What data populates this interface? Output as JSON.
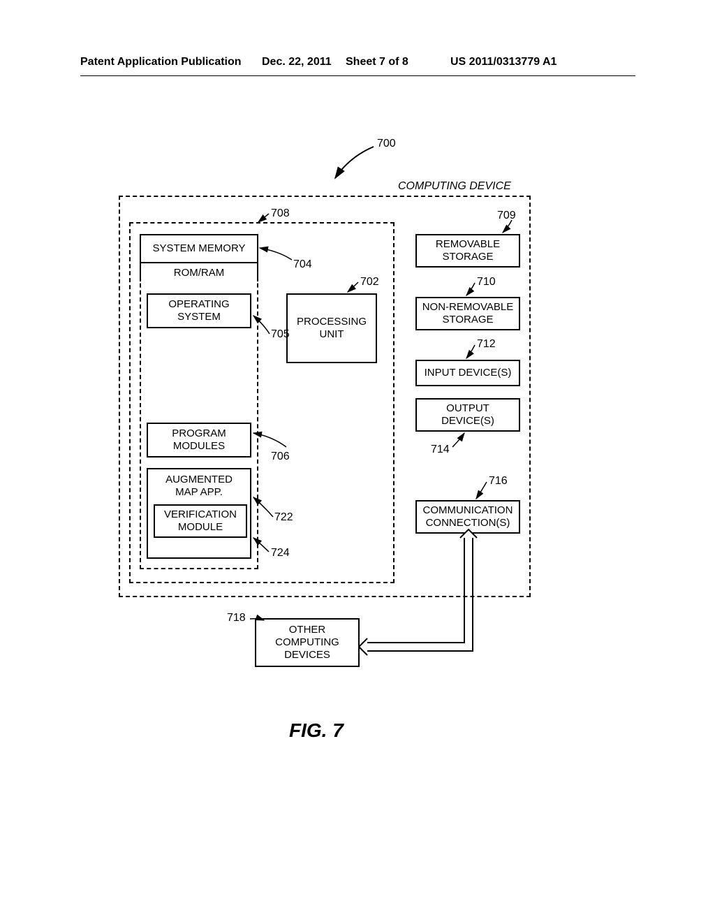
{
  "header": {
    "pub": "Patent Application Publication",
    "date": "Dec. 22, 2011",
    "sheet": "Sheet 7 of 8",
    "pubno": "US 2011/0313779 A1"
  },
  "labels": {
    "computing_device": "COMPUTING DEVICE",
    "system_memory": "SYSTEM MEMORY",
    "rom_ram": "ROM/RAM",
    "operating_system": "OPERATING\nSYSTEM",
    "program_modules": "PROGRAM\nMODULES",
    "augmented_map": "AUGMENTED\nMAP APP.",
    "verification": "VERIFICATION\nMODULE",
    "processing_unit": "PROCESSING\nUNIT",
    "removable_storage": "REMOVABLE\nSTORAGE",
    "non_removable_storage": "NON-REMOVABLE\nSTORAGE",
    "input_devices": "INPUT DEVICE(S)",
    "output_devices": "OUTPUT\nDEVICE(S)",
    "communication": "COMMUNICATION\nCONNECTION(S)",
    "other_devices": "OTHER\nCOMPUTING\nDEVICES",
    "fig": "FIG. 7"
  },
  "refs": {
    "r700": "700",
    "r702": "702",
    "r704": "704",
    "r705": "705",
    "r706": "706",
    "r708": "708",
    "r709": "709",
    "r710": "710",
    "r712": "712",
    "r714": "714",
    "r716": "716",
    "r718": "718",
    "r722": "722",
    "r724": "724"
  }
}
